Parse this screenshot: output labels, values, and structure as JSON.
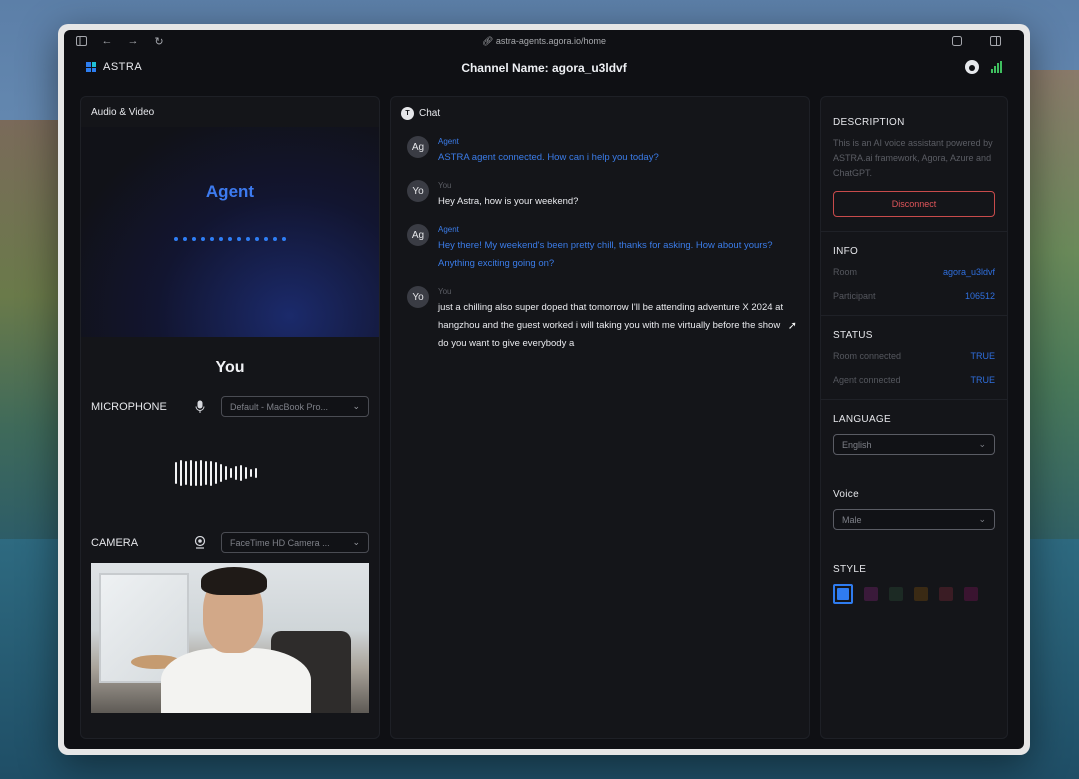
{
  "browser": {
    "url": "astra-agents.agora.io/home"
  },
  "header": {
    "logo_text": "ASTRA",
    "channel_label": "Channel Name: agora_u3ldvf",
    "signal_color": "#3fbf5f"
  },
  "left_panel": {
    "title": "Audio & Video",
    "agent_name": "Agent",
    "you_title": "You",
    "microphone": {
      "label": "MICROPHONE",
      "icon": "microphone-icon",
      "selected": "Default - MacBook Pro..."
    },
    "camera": {
      "label": "CAMERA",
      "icon": "camera-icon",
      "selected": "FaceTime HD Camera ..."
    }
  },
  "chat": {
    "title": "Chat",
    "messages": [
      {
        "avatar": "Ag",
        "sender": "Agent",
        "role": "agent",
        "text": "ASTRA agent connected. How can i help you today?"
      },
      {
        "avatar": "Yo",
        "sender": "You",
        "role": "user",
        "text": "Hey Astra, how is your weekend?"
      },
      {
        "avatar": "Ag",
        "sender": "Agent",
        "role": "agent",
        "text": "Hey there! My weekend's been pretty chill, thanks for asking. How about yours? Anything exciting going on?"
      },
      {
        "avatar": "Yo",
        "sender": "You",
        "role": "user",
        "text": "just a chilling also super doped that tomorrow I'll be attending adventure X 2024 at hangzhou and the guest worked i will taking you with me virtually before the show do you want to give everybody a"
      }
    ]
  },
  "right_panel": {
    "description": {
      "title": "DESCRIPTION",
      "text": "This is an AI voice assistant powered by ASTRA.ai framework, Agora, Azure and ChatGPT.",
      "disconnect_label": "Disconnect"
    },
    "info": {
      "title": "INFO",
      "room_label": "Room",
      "room_value": "agora_u3ldvf",
      "participant_label": "Participant",
      "participant_value": "106512"
    },
    "status": {
      "title": "STATUS",
      "room_connected_label": "Room connected",
      "room_connected_value": "TRUE",
      "agent_connected_label": "Agent connected",
      "agent_connected_value": "TRUE"
    },
    "language": {
      "title": "LANGUAGE",
      "selected": "English"
    },
    "voice": {
      "title": "Voice",
      "selected": "Male"
    },
    "style": {
      "title": "STYLE",
      "colors": [
        "#2f7cf0",
        "#3a1a3a",
        "#1c2a24",
        "#3a2a14",
        "#3a1c24",
        "#3a1430"
      ],
      "selected_index": 0
    }
  }
}
